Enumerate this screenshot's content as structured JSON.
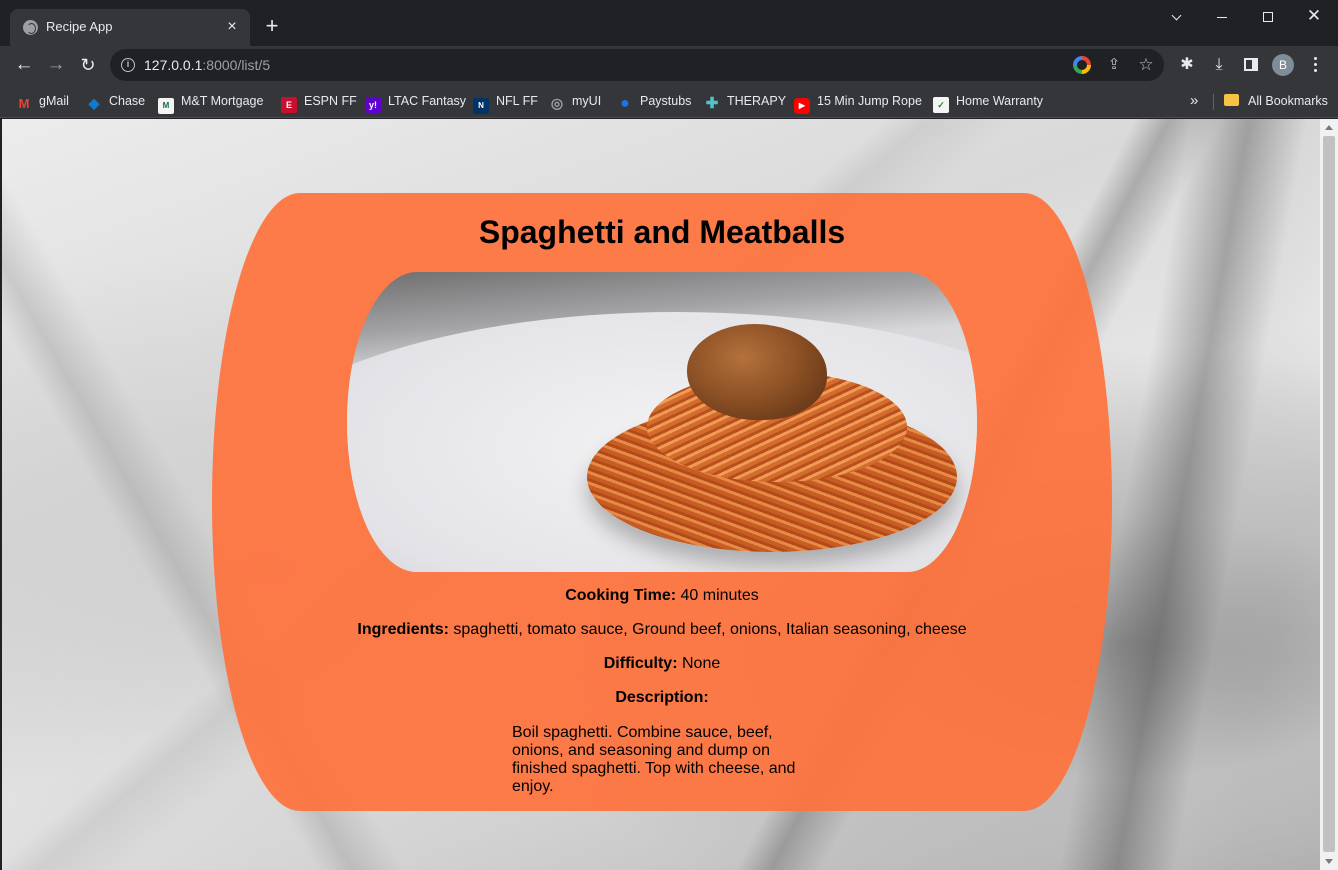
{
  "browser": {
    "tab_title": "Recipe App",
    "tab_close": "×",
    "new_tab": "+",
    "url_host": "127.0.0.1",
    "url_path": ":8000/list/5",
    "avatar_letter": "B",
    "window_controls": {
      "tab_search": "",
      "minimize": "",
      "maximize": "",
      "close": "✕"
    }
  },
  "bookmarks": [
    {
      "label": "gMail",
      "icon": "gmail-icon",
      "color": "#ea4335",
      "glyph": "M"
    },
    {
      "label": "Chase",
      "icon": "chase-icon",
      "color": "#117aca",
      "glyph": "◆"
    },
    {
      "label": "M&T Mortgage",
      "icon": "mt-icon",
      "color": "#f4f4f4",
      "glyph": "M"
    },
    {
      "label": "ESPN FF",
      "icon": "espn-icon",
      "color": "#c8102e",
      "glyph": "E"
    },
    {
      "label": "LTAC Fantasy",
      "icon": "yahoo-icon",
      "color": "#6001d2",
      "glyph": "y!"
    },
    {
      "label": "NFL FF",
      "icon": "nfl-icon",
      "color": "#013369",
      "glyph": "N"
    },
    {
      "label": "myUI",
      "icon": "globe-icon",
      "color": "#9aa0a6",
      "glyph": "◎"
    },
    {
      "label": "Paystubs",
      "icon": "paystubs-icon",
      "color": "#1a73e8",
      "glyph": "●"
    },
    {
      "label": "THERAPY",
      "icon": "therapy-icon",
      "color": "#4fc3c7",
      "glyph": "✚"
    },
    {
      "label": "15 Min Jump Rope",
      "icon": "youtube-icon",
      "color": "#ff0000",
      "glyph": "▶"
    },
    {
      "label": "Home Warranty",
      "icon": "warranty-icon",
      "color": "#f4f4f4",
      "glyph": "✓"
    }
  ],
  "bookmarks_more": "»",
  "all_bookmarks": "All Bookmarks",
  "recipe": {
    "title": "Spaghetti and Meatballs",
    "cooking_time_label": "Cooking Time:",
    "cooking_time": "40 minutes",
    "ingredients_label": "Ingredients:",
    "ingredients": "spaghetti, tomato sauce, Ground beef, onions, Italian seasoning, cheese",
    "difficulty_label": "Difficulty:",
    "difficulty": "None",
    "description_label": "Description:",
    "description": "Boil spaghetti. Combine sauce, beef, onions, and seasoning and dump on finished spaghetti. Top with cheese, and enjoy."
  },
  "colors": {
    "card": "#ff713c",
    "chrome_dark": "#202124",
    "chrome_toolbar": "#35363a"
  }
}
